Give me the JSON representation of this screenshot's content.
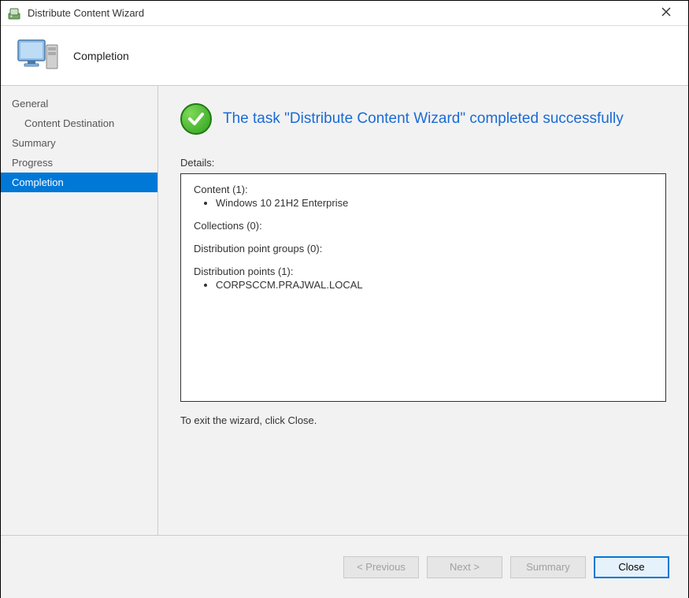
{
  "window": {
    "title": "Distribute Content Wizard"
  },
  "header": {
    "title": "Completion"
  },
  "sidebar": {
    "items": [
      {
        "label": "General",
        "indent": false,
        "active": false
      },
      {
        "label": "Content Destination",
        "indent": true,
        "active": false
      },
      {
        "label": "Summary",
        "indent": false,
        "active": false
      },
      {
        "label": "Progress",
        "indent": false,
        "active": false
      },
      {
        "label": "Completion",
        "indent": false,
        "active": true
      }
    ]
  },
  "completion": {
    "success_message": "The task \"Distribute Content Wizard\" completed successfully",
    "details_label": "Details:",
    "sections": {
      "content_header": "Content (1):",
      "content_item": "Windows 10 21H2 Enterprise",
      "collections_header": "Collections (0):",
      "dpg_header": "Distribution point groups (0):",
      "dp_header": "Distribution points (1):",
      "dp_item": "CORPSCCM.PRAJWAL.LOCAL"
    },
    "exit_text": "To exit the wizard, click Close."
  },
  "buttons": {
    "previous": "< Previous",
    "next": "Next >",
    "summary": "Summary",
    "close": "Close"
  }
}
